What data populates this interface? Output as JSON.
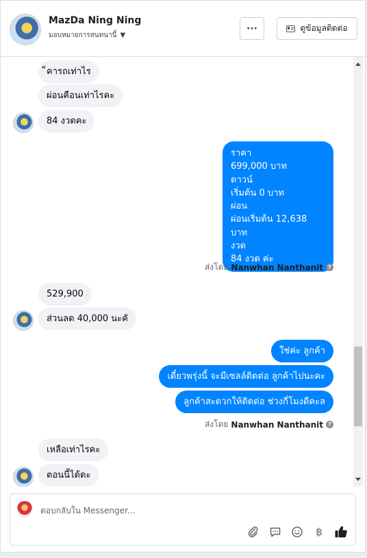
{
  "header": {
    "contact_name": "MazDa Ning Ning",
    "assign_label": "มอบหมายการสนทนานี้",
    "more_label": "···",
    "contact_info_label": "ดูข้อมูลติดต่อ"
  },
  "messages": [
    {
      "side": "in",
      "text": "็คารถเท่าไร"
    },
    {
      "side": "in",
      "text": "ผ่อนคือนเท่าไรคะ"
    },
    {
      "side": "in",
      "text": "84 งวดคะ"
    },
    {
      "side": "out",
      "lines": [
        "ราคา",
        "699,000 บาท",
        "ดาวน์",
        "เริ่มต้น 0 บาท",
        "ผ่อน",
        "ผ่อนเริ่มต้น 12,638 บาท",
        "งวด",
        "84 งวด ค่ะ"
      ]
    },
    {
      "side": "in",
      "text": "529,900"
    },
    {
      "side": "in",
      "text": "ส่วนลด 40,000 นะคั"
    },
    {
      "side": "out",
      "text": "ใช่ค่ะ ลูกค้า"
    },
    {
      "side": "out",
      "text": "เดี๋ยวพรุ่งนี้ จะมีเซลล์ติดต่อ ลูกค้าไปนะคะ"
    },
    {
      "side": "out",
      "text": "ลูกค้าสะดวกให้ติดต่อ ช่วงกี่โมงดีคะล"
    },
    {
      "side": "in",
      "text": "เหลือเท่าไรคะ"
    },
    {
      "side": "in",
      "text": "ตอนนี้ได้ดะ"
    }
  ],
  "sent_by": {
    "prefix": "ส่งโดย",
    "agent": "Nanwhan Nanthanit"
  },
  "composer": {
    "placeholder": "ตอบกลับใน Messenger...",
    "value": "",
    "tools": [
      "paperclip-icon",
      "speech-bubble-icon",
      "emoji-icon",
      "baht-icon",
      "thumbs-up-icon"
    ],
    "baht_symbol": "฿"
  },
  "colors": {
    "outgoing_bubble": "#0084ff",
    "incoming_bubble": "#f0f2f5"
  }
}
